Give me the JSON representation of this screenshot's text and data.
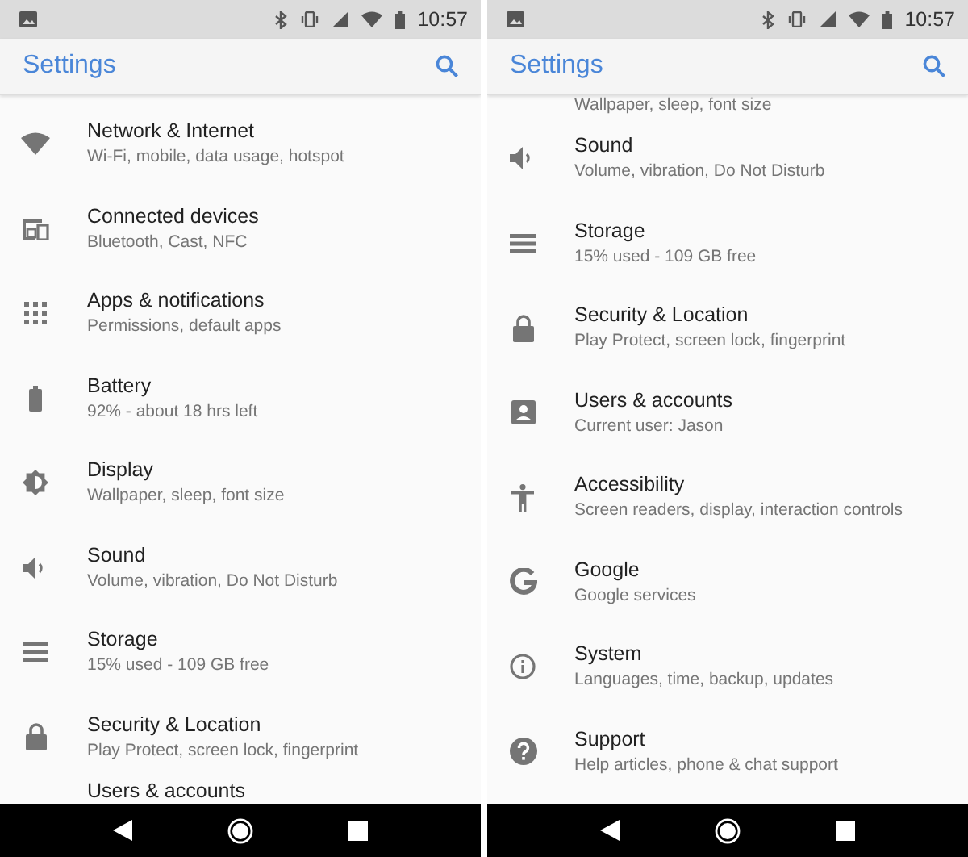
{
  "screens": [
    {
      "time": "10:57",
      "title": "Settings",
      "items": [
        {
          "kind": "network",
          "title": "Network & Internet",
          "subtitle": "Wi-Fi, mobile, data usage, hotspot"
        },
        {
          "kind": "devices",
          "title": "Connected devices",
          "subtitle": "Bluetooth, Cast, NFC"
        },
        {
          "kind": "apps",
          "title": "Apps & notifications",
          "subtitle": "Permissions, default apps"
        },
        {
          "kind": "battery",
          "title": "Battery",
          "subtitle": "92% - about 18 hrs left"
        },
        {
          "kind": "display",
          "title": "Display",
          "subtitle": "Wallpaper, sleep, font size"
        },
        {
          "kind": "sound",
          "title": "Sound",
          "subtitle": "Volume, vibration, Do Not Disturb"
        },
        {
          "kind": "storage",
          "title": "Storage",
          "subtitle": "15% used - 109 GB free"
        },
        {
          "kind": "security",
          "title": "Security & Location",
          "subtitle": "Play Protect, screen lock, fingerprint"
        },
        {
          "kind": "partial",
          "title": "Users & accounts"
        }
      ]
    },
    {
      "time": "10:57",
      "title": "Settings",
      "items": [
        {
          "kind": "partial",
          "subtitle": "Wallpaper, sleep, font size"
        },
        {
          "kind": "sound",
          "title": "Sound",
          "subtitle": "Volume, vibration, Do Not Disturb"
        },
        {
          "kind": "storage",
          "title": "Storage",
          "subtitle": "15% used - 109 GB free"
        },
        {
          "kind": "security",
          "title": "Security & Location",
          "subtitle": "Play Protect, screen lock, fingerprint"
        },
        {
          "kind": "users",
          "title": "Users & accounts",
          "subtitle": "Current user: Jason"
        },
        {
          "kind": "accessibility",
          "title": "Accessibility",
          "subtitle": "Screen readers, display, interaction controls"
        },
        {
          "kind": "google",
          "title": "Google",
          "subtitle": "Google services"
        },
        {
          "kind": "system",
          "title": "System",
          "subtitle": "Languages, time, backup, updates"
        },
        {
          "kind": "support",
          "title": "Support",
          "subtitle": "Help articles, phone & chat support"
        }
      ]
    }
  ]
}
